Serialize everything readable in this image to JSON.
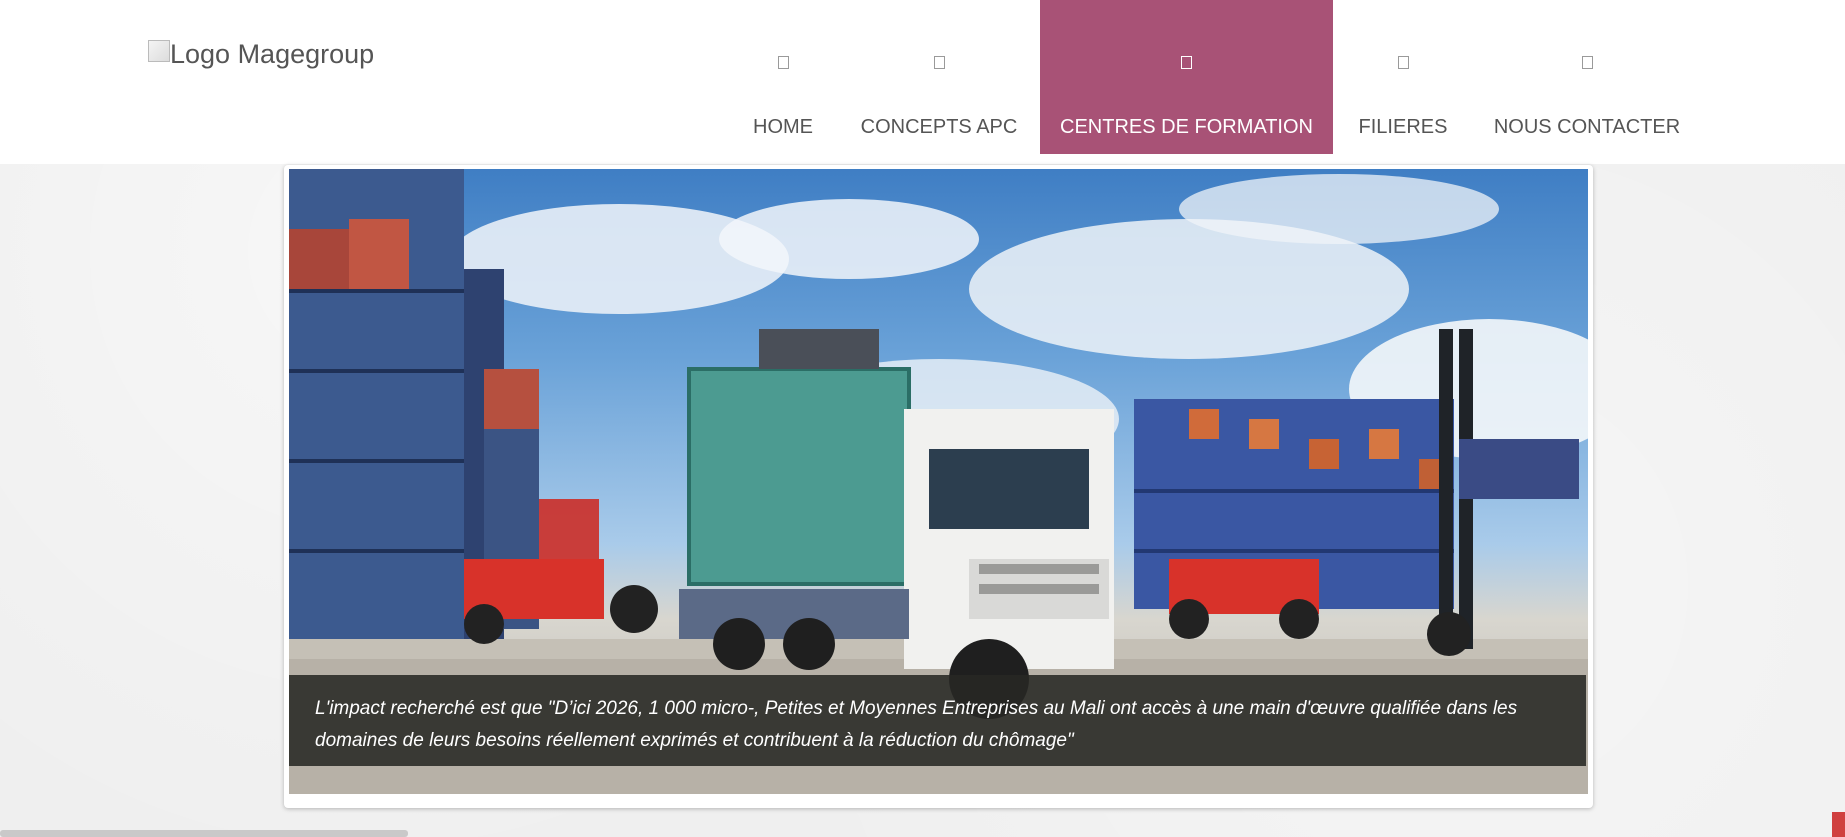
{
  "header": {
    "logo_alt": "Logo Magegroup"
  },
  "nav": {
    "items": [
      {
        "label": "HOME",
        "icon": "home-icon",
        "active": false
      },
      {
        "label": "CONCEPTS APC",
        "icon": "book-icon",
        "active": false
      },
      {
        "label": "CENTRES DE FORMATION",
        "icon": "building-icon",
        "active": true
      },
      {
        "label": "FILIERES",
        "icon": "list-icon",
        "active": false
      },
      {
        "label": "NOUS CONTACTER",
        "icon": "envelope-icon",
        "active": false
      }
    ]
  },
  "hero": {
    "image": "containers-truck-port-photo",
    "caption_line1": "L'impact recherché est que \"D’ici 2026, 1 000 micro-, Petites et Moyennes Entreprises au Mali ont accès à une main d'œuvre qualifiée dans les",
    "caption_line2": "domaines de leurs besoins réellement exprimés et contribuent à la réduction du chômage\""
  },
  "colors": {
    "active_nav": "#a85276",
    "caption_bg": "#28281f",
    "accent_red": "#d0403f"
  }
}
